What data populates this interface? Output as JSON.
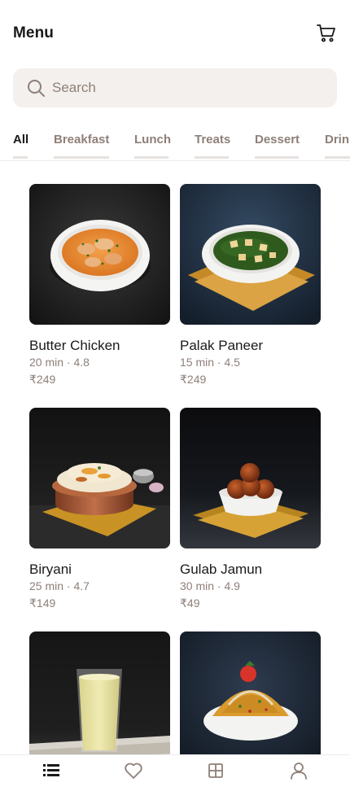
{
  "header": {
    "title": "Menu",
    "cart_icon": "cart-icon"
  },
  "search": {
    "placeholder": "Search",
    "value": "",
    "icon": "search-icon"
  },
  "tabs": [
    {
      "label": "All",
      "active": true
    },
    {
      "label": "Breakfast",
      "active": false
    },
    {
      "label": "Lunch",
      "active": false
    },
    {
      "label": "Treats",
      "active": false
    },
    {
      "label": "Dessert",
      "active": false
    },
    {
      "label": "Drinks",
      "active": false
    }
  ],
  "items": [
    {
      "name": "Butter Chicken",
      "meta": "20 min · 4.8",
      "price": "₹249"
    },
    {
      "name": "Palak Paneer",
      "meta": "15 min · 4.5",
      "price": "₹249"
    },
    {
      "name": "Biryani",
      "meta": "25 min · 4.7",
      "price": "₹149"
    },
    {
      "name": "Gulab Jamun",
      "meta": "30 min · 4.9",
      "price": "₹49"
    },
    {
      "name": "",
      "meta": "",
      "price": ""
    },
    {
      "name": "",
      "meta": "",
      "price": ""
    }
  ],
  "bottom_nav": [
    {
      "icon": "list-icon",
      "active": true
    },
    {
      "icon": "heart-icon",
      "active": false
    },
    {
      "icon": "grid-icon",
      "active": false
    },
    {
      "icon": "profile-icon",
      "active": false
    }
  ],
  "colors": {
    "text": "#1a1a1a",
    "muted": "#8e7f78",
    "search_bg": "#f3f0ed",
    "divider": "#ececec"
  }
}
